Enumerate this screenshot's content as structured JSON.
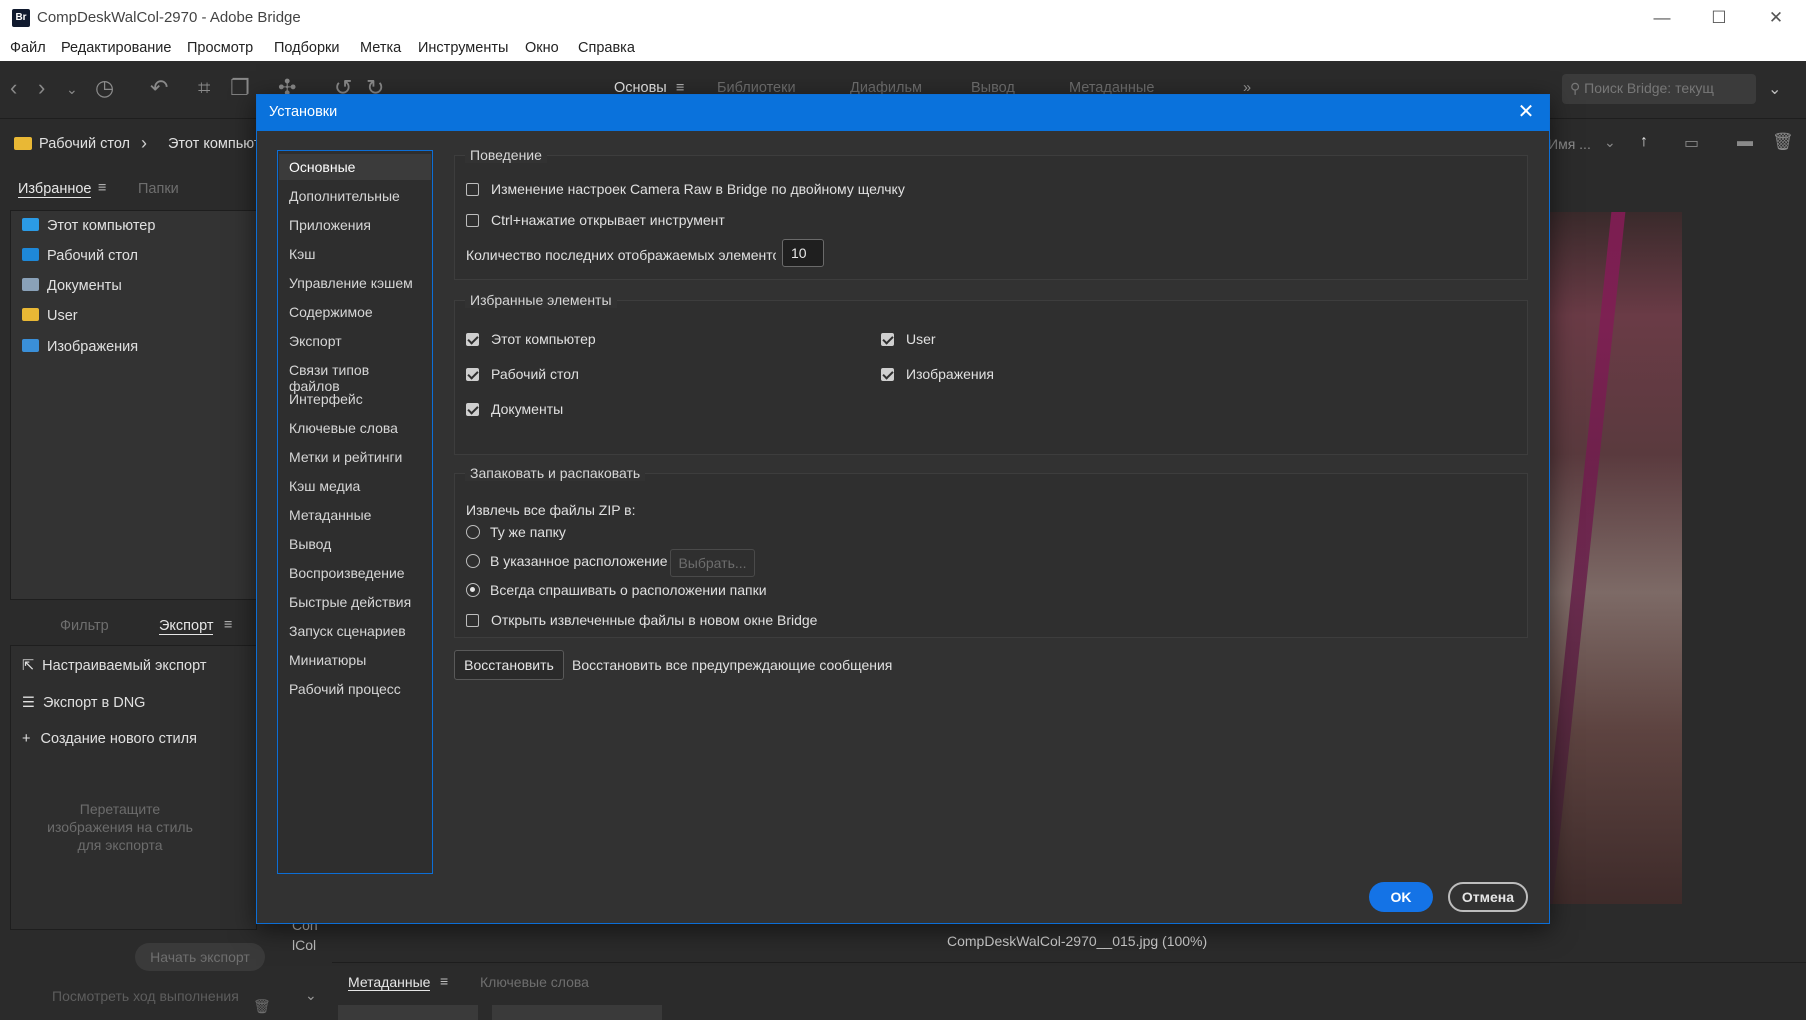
{
  "window": {
    "title": "CompDeskWalCol-2970 - Adobe Bridge",
    "app_icon": "Br",
    "controls": {
      "minimize": "—",
      "maximize": "☐",
      "close": "✕"
    }
  },
  "menu": [
    "Файл",
    "Редактирование",
    "Просмотр",
    "Подборки",
    "Метка",
    "Инструменты",
    "Окно",
    "Справка"
  ],
  "workspaces": {
    "active": "Основы",
    "others": [
      "Библиотеки",
      "Диафильм",
      "Вывод",
      "Метаданные"
    ],
    "more": "»"
  },
  "search": {
    "placeholder": "Поиск Bridge: текущ"
  },
  "path": {
    "items": [
      "Рабочий стол",
      "Этот компьюте"
    ],
    "separator": "›",
    "sort_label": "Имя ..."
  },
  "favorites_panel": {
    "tabs": [
      "Избранное",
      "Папки"
    ],
    "items": [
      "Этот компьютер",
      "Рабочий стол",
      "Документы",
      "User",
      "Изображения"
    ]
  },
  "export_panel": {
    "tabs": [
      "Фильтр",
      "Экспорт"
    ],
    "items": [
      "Настраиваемый экспорт",
      "Экспорт в DNG",
      "Создание нового стиля"
    ],
    "drop_hint": "Перетащите изображения на стиль для экспорта",
    "start_button": "Начать экспорт",
    "progress_link": "Посмотреть ход выполнения",
    "partial_text": [
      "Con",
      "lCol"
    ]
  },
  "preview": {
    "caption": "CompDeskWalCol-2970__015.jpg (100%)"
  },
  "bottom_tabs": [
    "Метаданные",
    "Ключевые слова"
  ],
  "dialog": {
    "title": "Установки",
    "categories": [
      "Основные",
      "Дополнительные",
      "Приложения",
      "Кэш",
      "Управление кэшем",
      "Содержимое",
      "Экспорт",
      "Связи типов файлов",
      "Интерфейс",
      "Ключевые слова",
      "Метки и рейтинги",
      "Кэш медиа",
      "Метаданные",
      "Вывод",
      "Воспроизведение",
      "Быстрые действия",
      "Запуск сценариев",
      "Миниатюры",
      "Рабочий процесс"
    ],
    "selected_category": "Основные",
    "behavior": {
      "label": "Поведение",
      "camera_raw": "Изменение настроек Camera Raw в Bridge по двойному щелчку",
      "ctrl_click": "Ctrl+нажатие открывает инструмент",
      "recent_label": "Количество последних отображаемых элементов",
      "recent_value": "10"
    },
    "favorites": {
      "label": "Избранные элементы",
      "items": [
        "Этот компьютер",
        "User",
        "Рабочий стол",
        "Изображения",
        "Документы"
      ]
    },
    "zip": {
      "label": "Запаковать и распаковать",
      "extract_label": "Извлечь все файлы ZIP в:",
      "option_same": "Ту же папку",
      "option_location": "В указанное расположение",
      "choose_button": "Выбрать...",
      "option_ask": "Всегда спрашивать о расположении папки",
      "open_new_window": "Открыть извлеченные файлы в новом окне Bridge"
    },
    "restore_button": "Восстановить",
    "restore_text": "Восстановить все предупреждающие сообщения",
    "ok": "OK",
    "cancel": "Отмена"
  },
  "colors": {
    "accent": "#0a72dc",
    "ok_button": "#1473e6",
    "panel_bg": "#2b2b2b",
    "dialog_bg": "#323232"
  }
}
